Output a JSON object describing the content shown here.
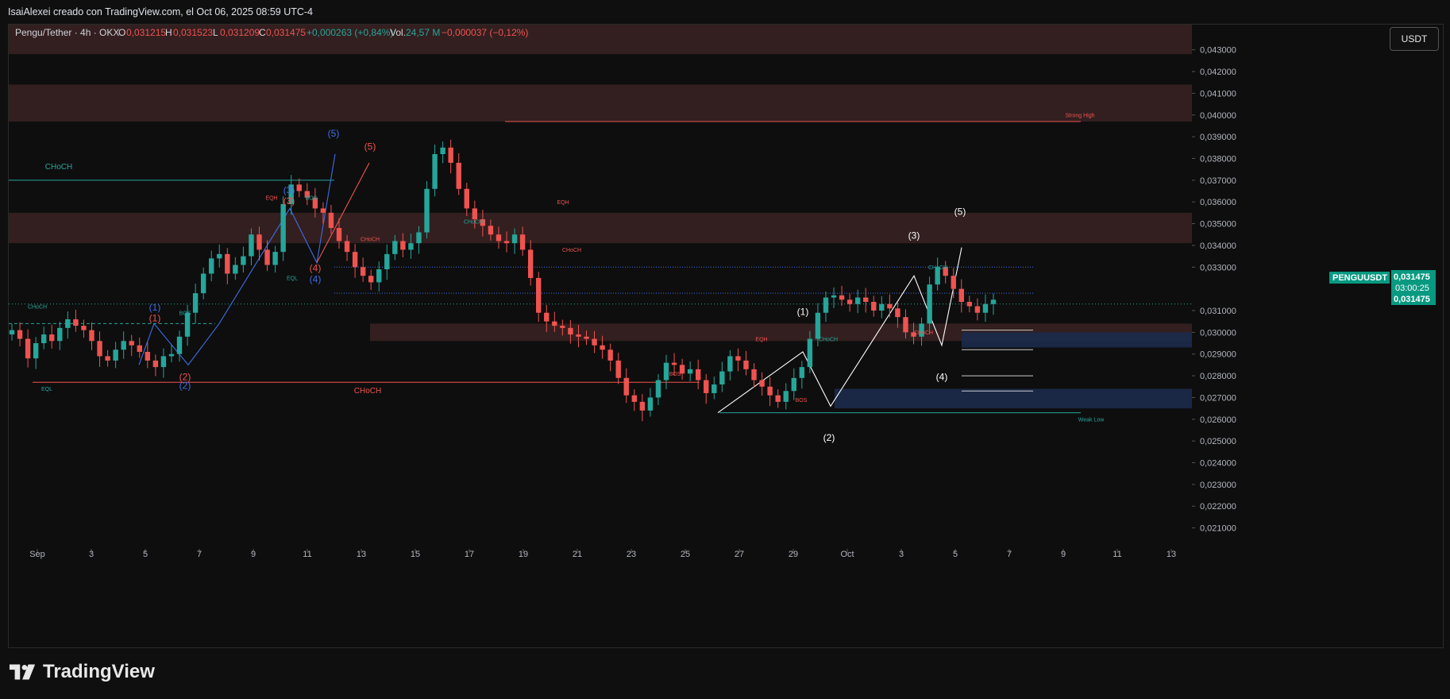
{
  "header": {
    "attribution": "IsaiAlexei creado con TradingView.com, el Oct 06, 2025 08:59 UTC-4"
  },
  "legend": {
    "symbol": "Pengu/Tether · 4h · OKX",
    "o_label": "O",
    "o_value": "0,031215",
    "h_label": "H",
    "h_value": "0,031523",
    "l_label": "L",
    "l_value": "0,031209",
    "c_label": "C",
    "c_value": "0,031475",
    "change": "+0,000263 (+0,84%)",
    "vol_label": "Vol.",
    "vol_value": "24,57 M",
    "vol_change": "−0,000037 (−0,12%)"
  },
  "currency_button": "USDT",
  "price_badge": {
    "ticker": "PENGUUSDT",
    "price": "0,031475",
    "countdown": "03:00:25",
    "price2": "0,031475"
  },
  "brand": "TradingView",
  "colors": {
    "up": "#26a69a",
    "down": "#ef5350",
    "supply_zone": "#3a2222",
    "demand_zone": "#1b2a4a",
    "wave_blue": "#3d6ee6",
    "wave_red": "#ef5350",
    "wave_white": "#ffffff"
  },
  "chart_data": {
    "type": "candlestick",
    "y_axis_ticks": [
      "0,043000",
      "0,042000",
      "0,041000",
      "0,040000",
      "0,039000",
      "0,038000",
      "0,037000",
      "0,036000",
      "0,035000",
      "0,034000",
      "0,033000",
      "0,031000",
      "0,030000",
      "0,029000",
      "0,028000",
      "0,027000",
      "0,026000",
      "0,025000",
      "0,024000",
      "0,023000",
      "0,022000",
      "0,021000"
    ],
    "x_axis_ticks": [
      "Sep",
      "3",
      "5",
      "7",
      "9",
      "11",
      "13",
      "15",
      "17",
      "19",
      "21",
      "23",
      "25",
      "27",
      "29",
      "Oct",
      "3",
      "5",
      "7",
      "9",
      "11",
      "13"
    ],
    "ylim": [
      0.0204,
      0.0435
    ],
    "close_series": [
      0.0301,
      0.0297,
      0.0288,
      0.0295,
      0.0299,
      0.0296,
      0.0302,
      0.0306,
      0.0303,
      0.0301,
      0.0296,
      0.0289,
      0.0287,
      0.0292,
      0.0296,
      0.0294,
      0.0291,
      0.0287,
      0.0284,
      0.0289,
      0.029,
      0.0298,
      0.0309,
      0.0318,
      0.0327,
      0.0334,
      0.0336,
      0.0327,
      0.0331,
      0.0335,
      0.0345,
      0.0338,
      0.0331,
      0.0337,
      0.0359,
      0.0368,
      0.0365,
      0.0362,
      0.0357,
      0.0355,
      0.0348,
      0.0342,
      0.0337,
      0.033,
      0.0326,
      0.0323,
      0.0329,
      0.0336,
      0.0342,
      0.0338,
      0.0341,
      0.0346,
      0.0366,
      0.0382,
      0.0385,
      0.0378,
      0.0366,
      0.0357,
      0.0352,
      0.0349,
      0.0345,
      0.0342,
      0.0341,
      0.0345,
      0.0338,
      0.0325,
      0.0309,
      0.0305,
      0.0303,
      0.0302,
      0.0299,
      0.0298,
      0.0297,
      0.0294,
      0.0292,
      0.0287,
      0.0279,
      0.0271,
      0.0268,
      0.0264,
      0.027,
      0.0278,
      0.0286,
      0.0285,
      0.0281,
      0.0283,
      0.0278,
      0.0272,
      0.0276,
      0.0282,
      0.0289,
      0.0287,
      0.0283,
      0.0278,
      0.0275,
      0.0271,
      0.0268,
      0.0273,
      0.0279,
      0.0284,
      0.0297,
      0.0309,
      0.0316,
      0.0317,
      0.0315,
      0.0313,
      0.0316,
      0.0314,
      0.031,
      0.0313,
      0.0311,
      0.0307,
      0.03,
      0.0298,
      0.0304,
      0.0322,
      0.033,
      0.0326,
      0.032,
      0.0314,
      0.0312,
      0.0309,
      0.0313,
      0.0315
    ],
    "zones": [
      {
        "kind": "supply",
        "from": 0.0428,
        "to": 0.0448
      },
      {
        "kind": "supply",
        "from": 0.0397,
        "to": 0.0414
      },
      {
        "kind": "supply",
        "from": 0.0341,
        "to": 0.0355
      },
      {
        "kind": "supply",
        "from": 0.0296,
        "to": 0.0304
      },
      {
        "kind": "demand",
        "from": 0.0293,
        "to": 0.03
      },
      {
        "kind": "demand",
        "from": 0.0265,
        "to": 0.0274
      }
    ],
    "annotations": {
      "choch": "CHoCH",
      "bos": "BOS",
      "eqh": "EQH",
      "eql": "EQL",
      "strong_high": "Strong High",
      "weak_low": "Weak Low",
      "wave1": "(1)",
      "wave2": "(2)",
      "wave3": "(3)",
      "wave4": "(4)",
      "wave5": "(5)"
    }
  }
}
